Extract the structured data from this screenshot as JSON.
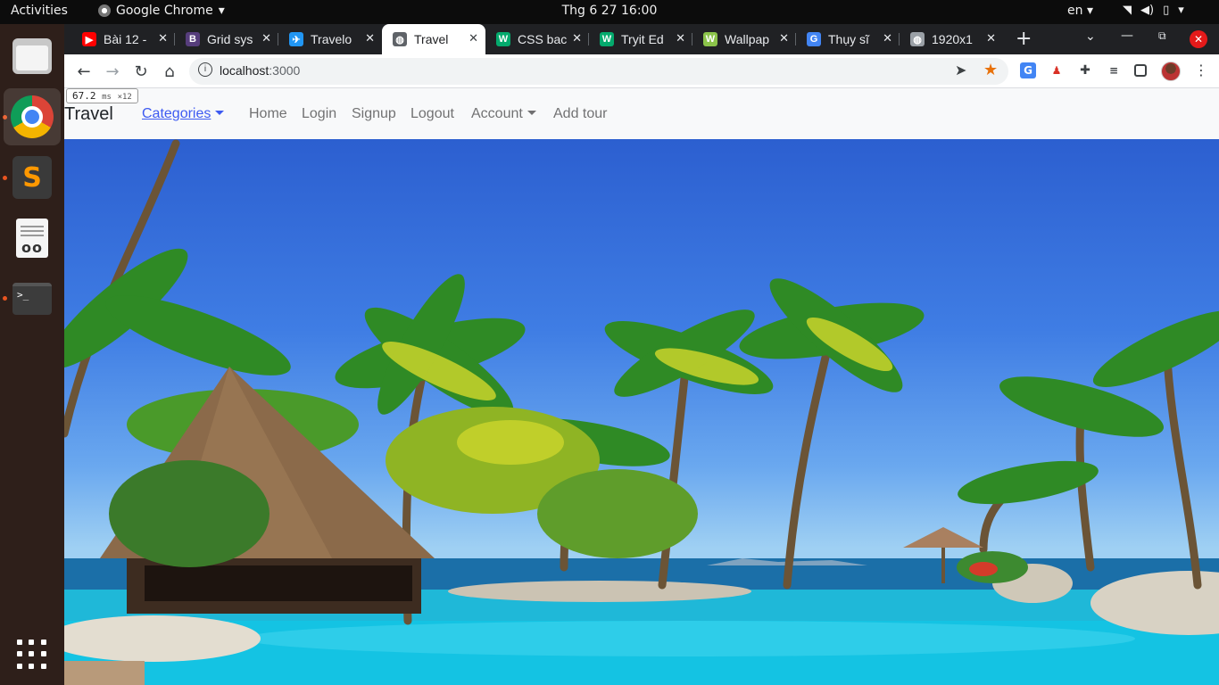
{
  "topbar": {
    "activities": "Activities",
    "app_name": "Google Chrome",
    "clock": "Thg 6 27  16:00",
    "language": "en"
  },
  "dock": {
    "apps": [
      "files",
      "google-chrome",
      "sublime-text",
      "document-viewer",
      "terminal"
    ],
    "terminal_prompt": ">_"
  },
  "browser": {
    "tabs": [
      {
        "title": "Bài 12 -",
        "icon": "youtube-icon",
        "color": "#ff0000"
      },
      {
        "title": "Grid sys",
        "icon": "bootstrap-icon",
        "color": "#563d7c"
      },
      {
        "title": "Travelo",
        "icon": "travelo-icon",
        "color": "#2196f3"
      },
      {
        "title": "Travel",
        "icon": "globe-icon",
        "color": "#5f6368",
        "active": true
      },
      {
        "title": "CSS bac",
        "icon": "w3schools-icon",
        "color": "#04aa6d"
      },
      {
        "title": "Tryit Ed",
        "icon": "w3schools-icon",
        "color": "#04aa6d"
      },
      {
        "title": "Wallpap",
        "icon": "wallpaper-icon",
        "color": "#8bc34a"
      },
      {
        "title": "Thụy sĩ",
        "icon": "google-icon",
        "color": "#4285f4"
      },
      {
        "title": "1920x1",
        "icon": "globe-icon",
        "color": "#9aa0a6"
      }
    ],
    "url_host": "localhost",
    "url_port": ":3000",
    "accent_color": "#e8710a"
  },
  "perf_badge": {
    "value": "67.2",
    "unit": "ms",
    "multiplier": "×12"
  },
  "site": {
    "brand": "Travel",
    "nav": {
      "categories": "Categories",
      "home": "Home",
      "login": "Login",
      "signup": "Signup",
      "logout": "Logout",
      "account": "Account",
      "add_tour": "Add tour"
    },
    "link_color": "#3d5af1",
    "navbar_bg": "#f8f9fa"
  }
}
